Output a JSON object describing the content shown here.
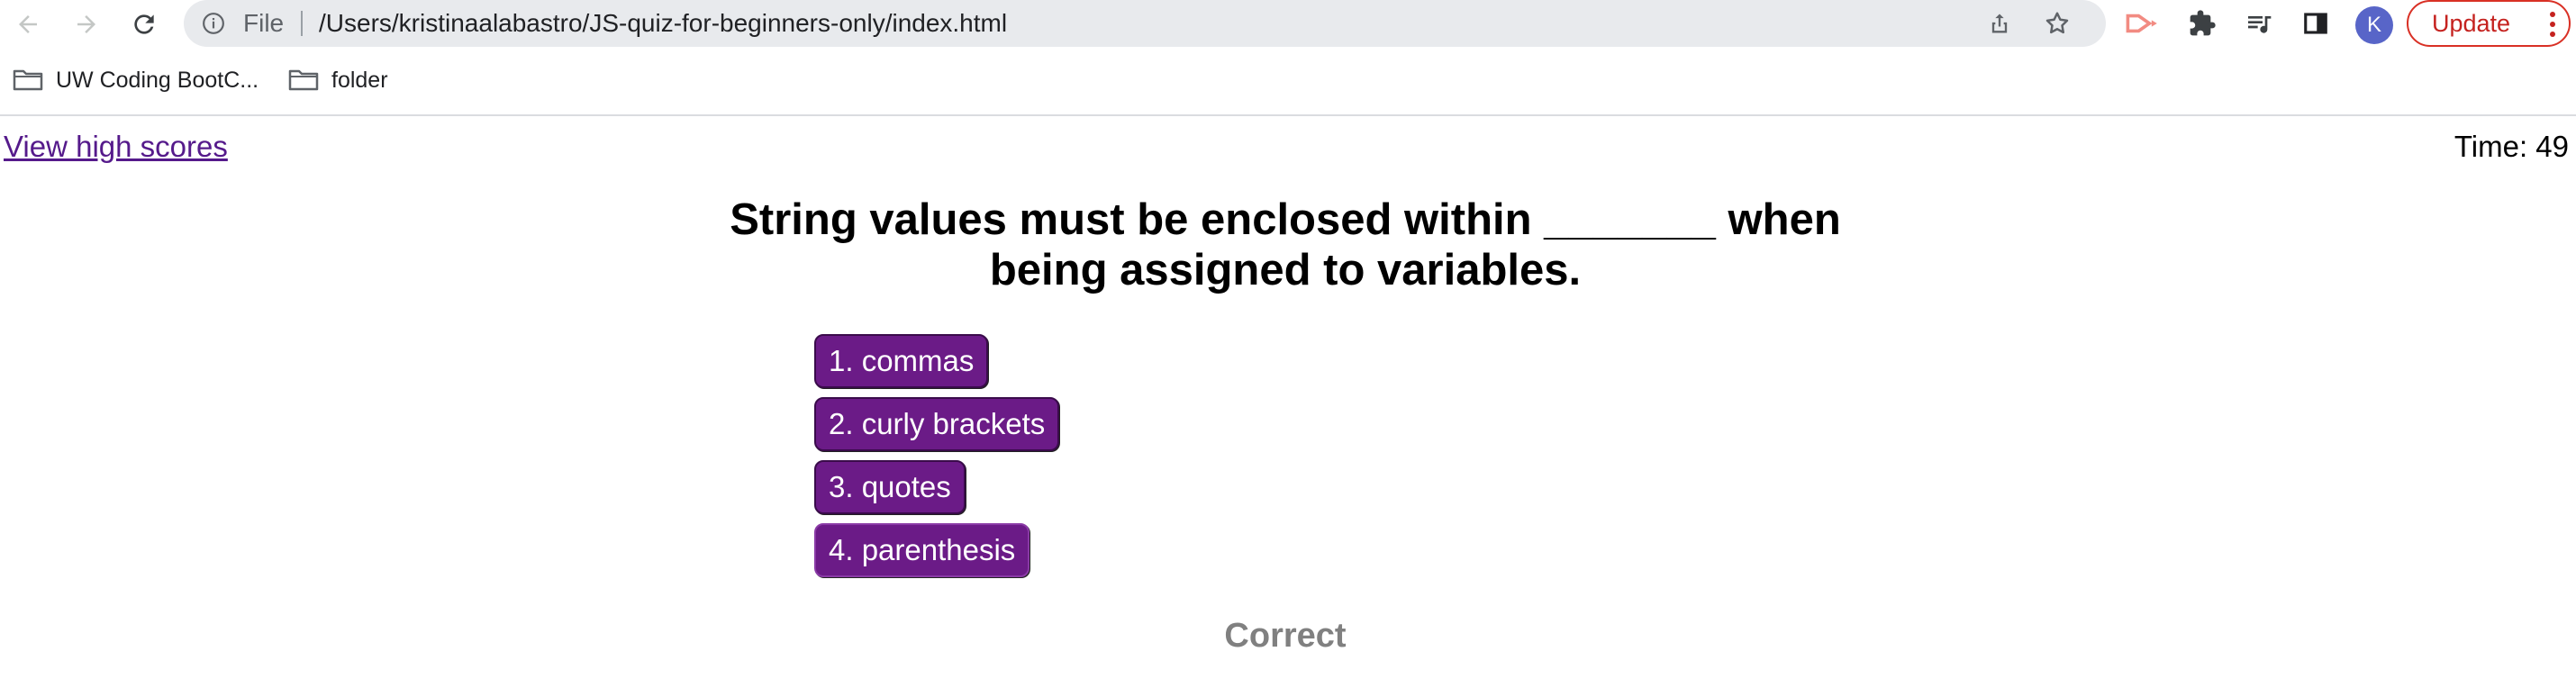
{
  "browser": {
    "omnibox": {
      "scheme_label": "File",
      "url": "/Users/kristinaalabastro/JS-quiz-for-beginners-only/index.html"
    },
    "profile_initial": "K",
    "update_label": "Update",
    "bookmarks": [
      {
        "label": "UW Coding BootC...",
        "icon": "folder-icon"
      },
      {
        "label": "folder",
        "icon": "folder-icon"
      }
    ],
    "colors": {
      "update_accent": "#d93025",
      "avatar_bg": "#5865c8"
    }
  },
  "quiz": {
    "high_scores_link": "View high scores",
    "timer": "Time: 49",
    "question": "String values must be enclosed within _______ when being assigned to variables.",
    "answers": [
      "1. commas",
      "2. curly brackets",
      "3. quotes",
      "4. parenthesis"
    ],
    "feedback": "Correct",
    "colors": {
      "answer_bg": "#6b1b87",
      "answer_text": "#ffffff",
      "feedback_text": "#808080",
      "link": "#551a8b"
    }
  }
}
